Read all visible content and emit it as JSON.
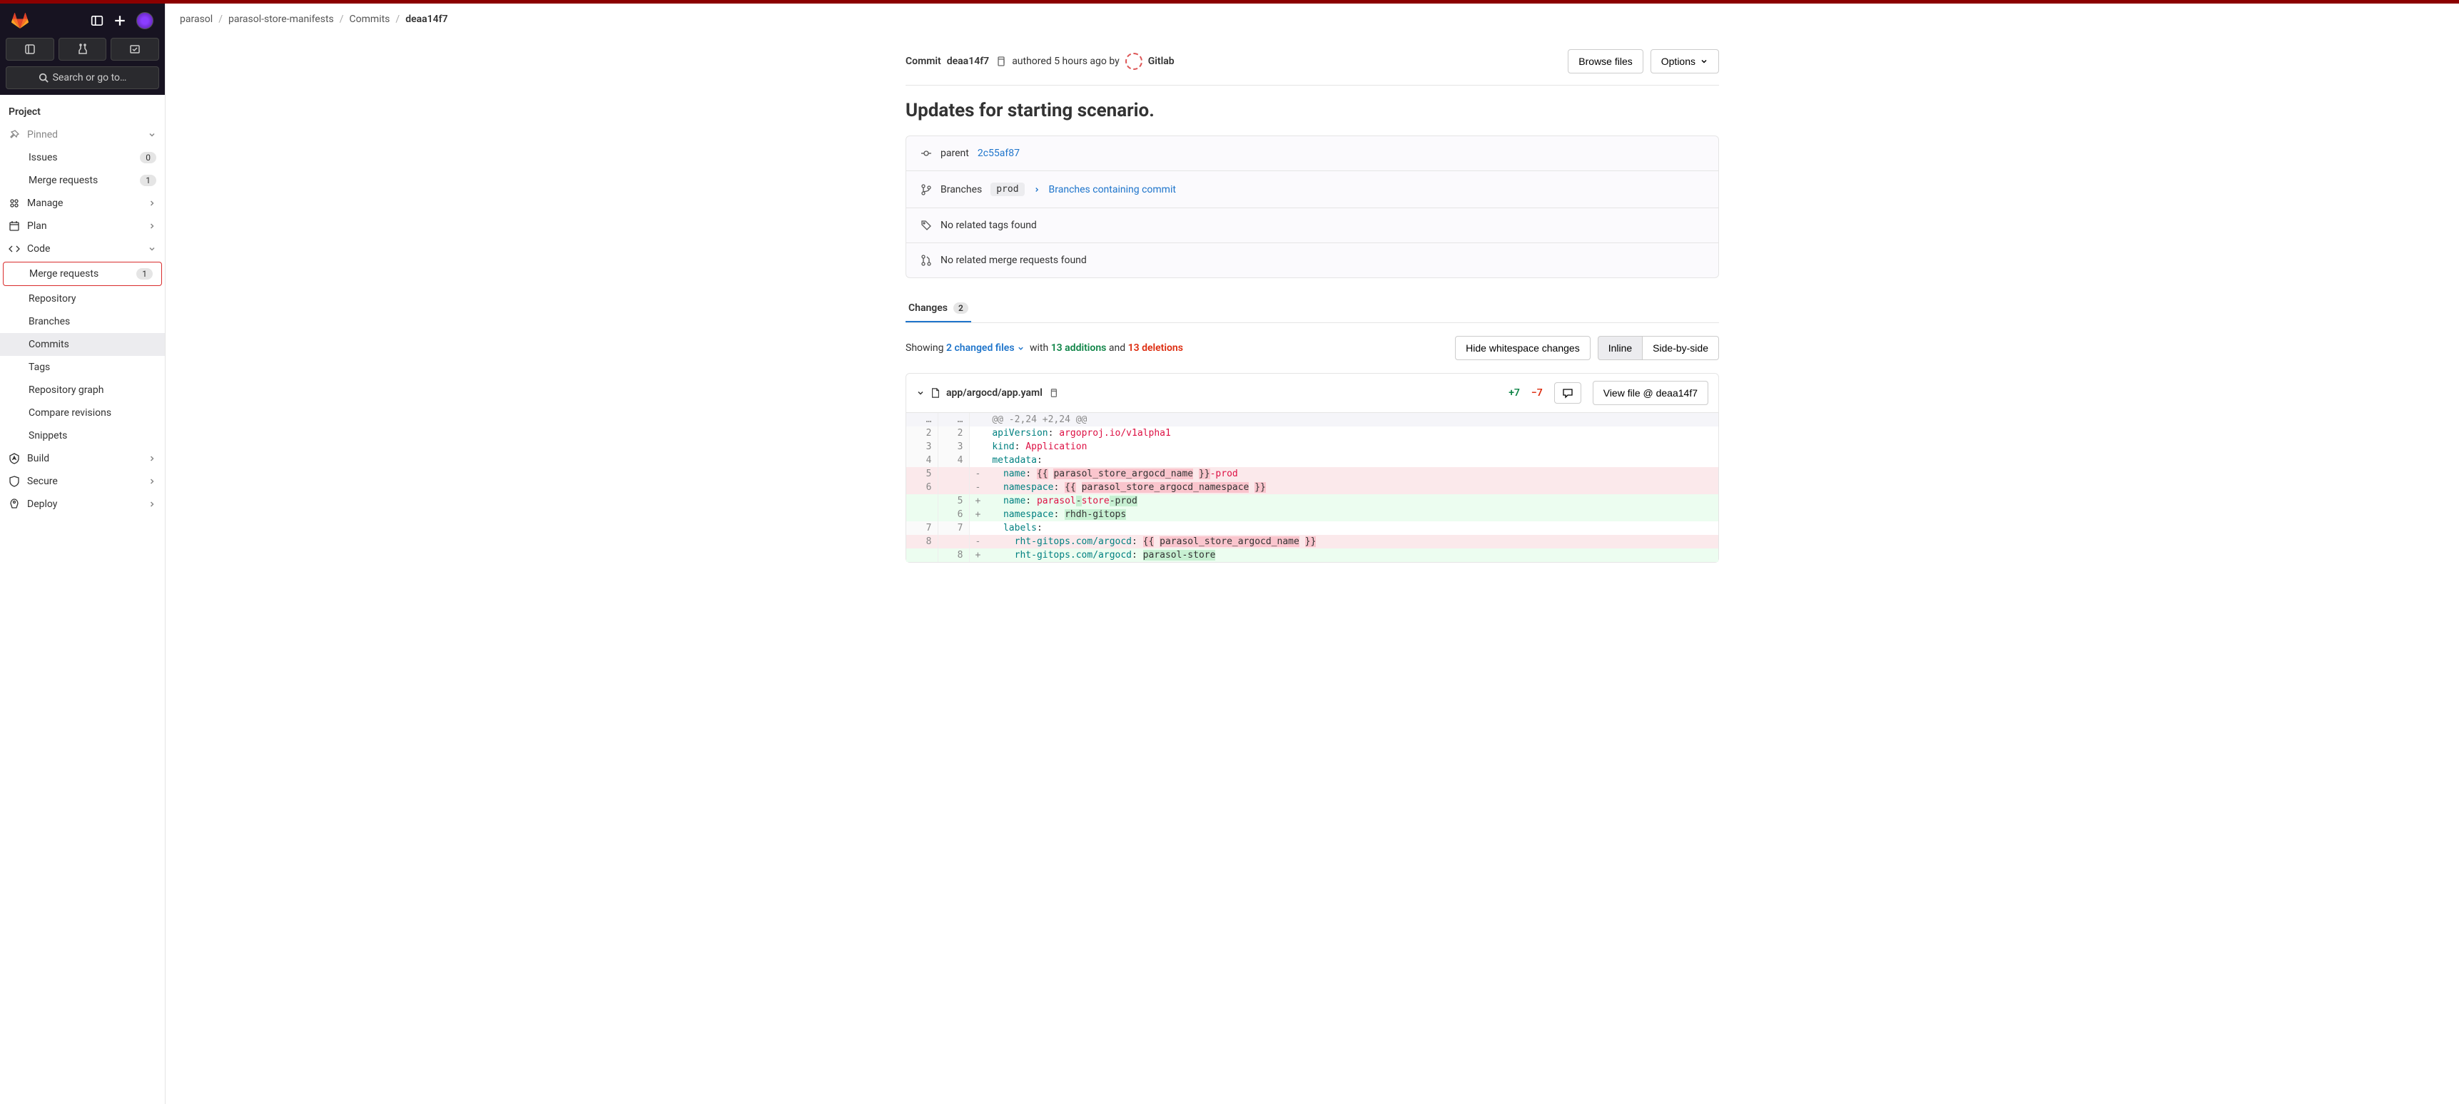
{
  "breadcrumb": {
    "items": [
      "parasol",
      "parasol-store-manifests",
      "Commits"
    ],
    "current": "deaa14f7"
  },
  "sidebar": {
    "search_label": "Search or go to…",
    "project_label": "Project",
    "pinned_label": "Pinned",
    "issues": {
      "label": "Issues",
      "count": "0"
    },
    "mr_pinned": {
      "label": "Merge requests",
      "count": "1"
    },
    "manage": "Manage",
    "plan": "Plan",
    "code": "Code",
    "code_children": {
      "merge_requests": {
        "label": "Merge requests",
        "count": "1"
      },
      "repository": "Repository",
      "branches": "Branches",
      "commits": "Commits",
      "tags": "Tags",
      "repo_graph": "Repository graph",
      "compare": "Compare revisions",
      "snippets": "Snippets"
    },
    "build": "Build",
    "secure": "Secure",
    "deploy": "Deploy"
  },
  "commit": {
    "label": "Commit",
    "sha": "deaa14f7",
    "authored_text": "authored 5 hours ago by",
    "author": "Gitlab",
    "browse_files": "Browse files",
    "options": "Options",
    "title": "Updates for starting scenario.",
    "parent_label": "parent",
    "parent_sha": "2c55af87",
    "branches_label": "Branches",
    "branch_tag": "prod",
    "branches_link": "Branches containing commit",
    "no_tags": "No related tags found",
    "no_mr": "No related merge requests found"
  },
  "tabs": {
    "changes": "Changes",
    "changes_count": "2"
  },
  "changes_summary": {
    "showing": "Showing",
    "files": "2 changed files",
    "with": "with",
    "additions": "13 additions",
    "and": "and",
    "deletions": "13 deletions",
    "hide_ws": "Hide whitespace changes",
    "inline": "Inline",
    "side": "Side-by-side"
  },
  "file": {
    "path": "app/argocd/app.yaml",
    "stat_add": "+7",
    "stat_del": "−7",
    "view_at": "View file @ deaa14f7"
  },
  "diff": {
    "hunk": "@@ -2,24 +2,24 @@",
    "lines": [
      {
        "old": "2",
        "new": "2",
        "type": "ctx",
        "html": "<span class='tok-key'>apiVersion</span>: <span class='tok-str'>argoproj.io/v1alpha1</span>"
      },
      {
        "old": "3",
        "new": "3",
        "type": "ctx",
        "html": "<span class='tok-key'>kind</span>: <span class='tok-str'>Application</span>"
      },
      {
        "old": "4",
        "new": "4",
        "type": "ctx",
        "html": "<span class='tok-key'>metadata</span>:"
      },
      {
        "old": "5",
        "new": "",
        "type": "del",
        "html": "  <span class='tok-key'>name</span>: <span class='hl-del'>{{</span> <span class='hl-del'>parasol_store_argocd_name</span> <span class='hl-del'>}}</span><span class='tok-str'>-prod</span>"
      },
      {
        "old": "6",
        "new": "",
        "type": "del",
        "html": "  <span class='tok-key'>namespace</span>: <span class='hl-del'>{{</span> <span class='hl-del'>parasol_store_argocd_namespace</span> <span class='hl-del'>}}</span>"
      },
      {
        "old": "",
        "new": "5",
        "type": "add",
        "html": "  <span class='tok-key'>name</span>: <span class='tok-str'>parasol</span><span class='hl-add'>-</span><span class='tok-str'>store</span><span class='hl-add'>-prod</span>"
      },
      {
        "old": "",
        "new": "6",
        "type": "add",
        "html": "  <span class='tok-key'>namespace</span>: <span class='hl-add'>rhdh-gitops</span>"
      },
      {
        "old": "7",
        "new": "7",
        "type": "ctx",
        "html": "  <span class='tok-key'>labels</span>:"
      },
      {
        "old": "8",
        "new": "",
        "type": "del",
        "html": "    <span class='tok-key'>rht-gitops.com/argocd</span>: <span class='hl-del'>{{</span> <span class='hl-del'>parasol_store_argocd_name</span> <span class='hl-del'>}}</span>"
      },
      {
        "old": "",
        "new": "8",
        "type": "add",
        "html": "    <span class='tok-key'>rht-gitops.com/argocd</span>: <span class='hl-add'>parasol-store</span>"
      }
    ]
  }
}
